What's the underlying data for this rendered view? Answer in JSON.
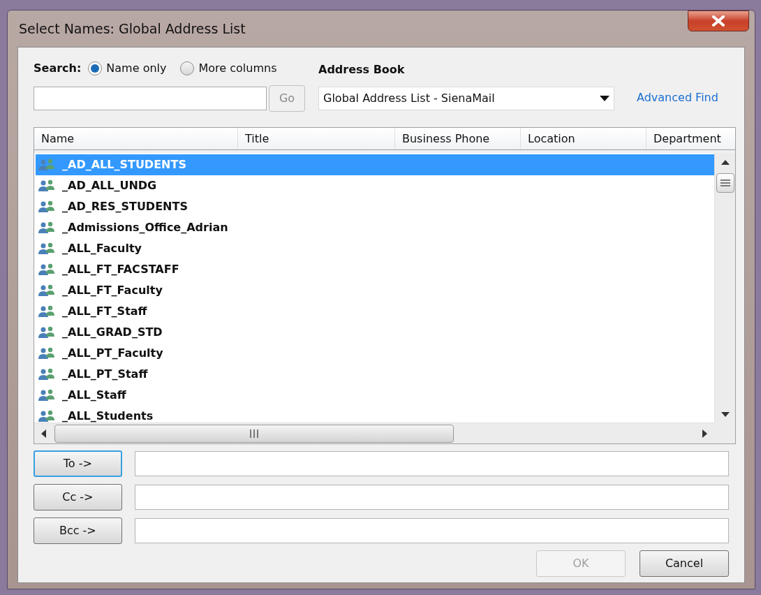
{
  "window": {
    "title": "Select Names: Global Address List"
  },
  "search": {
    "label": "Search:",
    "options": [
      {
        "label": "Name only",
        "selected": true
      },
      {
        "label": "More columns",
        "selected": false
      }
    ],
    "go_button": {
      "label": "Go",
      "disabled": true
    }
  },
  "address_book": {
    "label": "Address Book",
    "value": "Global Address List - SienaMail"
  },
  "advanced_find": "Advanced Find",
  "columns": [
    "Name",
    "Title",
    "Business Phone",
    "Location",
    "Department"
  ],
  "rows": [
    {
      "name": "_AD_ALL_STUDENTS",
      "selected": true
    },
    {
      "name": "_AD_ALL_UNDG",
      "selected": false
    },
    {
      "name": "_AD_RES_STUDENTS",
      "selected": false
    },
    {
      "name": "_Admissions_Office_Adrian",
      "selected": false
    },
    {
      "name": "_ALL_Faculty",
      "selected": false
    },
    {
      "name": "_ALL_FT_FACSTAFF",
      "selected": false
    },
    {
      "name": "_ALL_FT_Faculty",
      "selected": false
    },
    {
      "name": "_ALL_FT_Staff",
      "selected": false
    },
    {
      "name": "_ALL_GRAD_STD",
      "selected": false
    },
    {
      "name": "_ALL_PT_Faculty",
      "selected": false
    },
    {
      "name": "_ALL_PT_Staff",
      "selected": false
    },
    {
      "name": "_ALL_Staff",
      "selected": false
    },
    {
      "name": "_ALL_Students",
      "selected": false
    }
  ],
  "recipients": [
    {
      "label": "To ->",
      "focused": true
    },
    {
      "label": "Cc ->",
      "focused": false
    },
    {
      "label": "Bcc ->",
      "focused": false
    }
  ],
  "buttons": [
    {
      "label": "OK",
      "disabled": true
    },
    {
      "label": "Cancel",
      "disabled": false
    }
  ]
}
